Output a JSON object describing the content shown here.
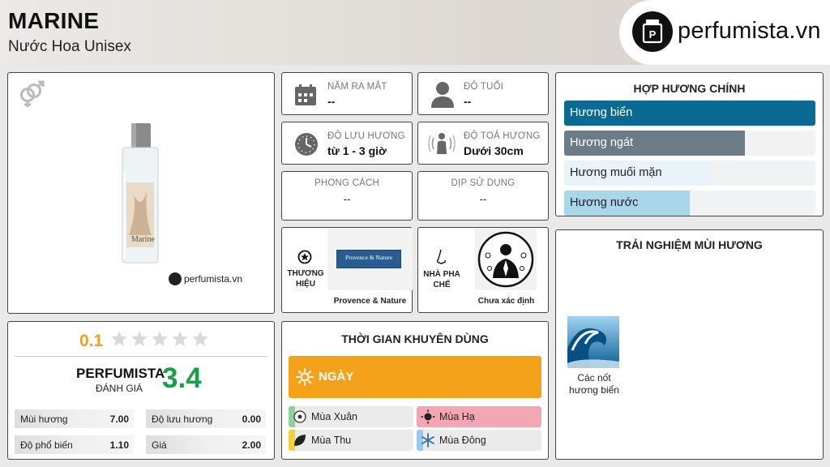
{
  "header": {
    "title": "MARINE",
    "subtitle": "Nước Hoa Unisex",
    "logo_text": "perfumista.vn"
  },
  "product": {
    "watermark": "perfumista.vn",
    "bottle_label": "Marine",
    "gender_icon": "unisex-gender-icon"
  },
  "info": {
    "release_label": "NĂM RA MẮT",
    "release_value": "--",
    "age_label": "ĐỘ TUỔI",
    "age_value": "--",
    "longevity_label": "ĐỘ LƯU HƯƠNG",
    "longevity_value": "từ 1 - 3 giờ",
    "sillage_label": "ĐỘ TOẢ HƯƠNG",
    "sillage_value": "Dưới 30cm",
    "style_label": "PHONG CÁCH",
    "style_value": "--",
    "occasion_label": "DỊP SỬ DỤNG",
    "occasion_value": "--"
  },
  "brand": {
    "label": "THƯƠNG HIỆU",
    "logo_text": "Provence & Nature",
    "name": "Provence & Nature"
  },
  "perfumer": {
    "label": "NHÀ PHA CHẾ",
    "name": "Chưa xác định"
  },
  "accords": {
    "title": "HỢP HƯƠNG CHÍNH",
    "items": [
      {
        "label": "Hương biển",
        "pct": 100,
        "color": "#0a6a93",
        "text_color": "#ffffff"
      },
      {
        "label": "Hương ngát",
        "pct": 72,
        "color": "#6b7b87",
        "text_color": "#ffffff"
      },
      {
        "label": "Hương muối mặn",
        "pct": 58,
        "color": "#e9f3fa",
        "text_color": "#222222"
      },
      {
        "label": "Hương nước",
        "pct": 50,
        "color": "#a9d6e8",
        "text_color": "#222222"
      }
    ]
  },
  "rating": {
    "user_score": "0.1",
    "stars": 0.1,
    "brand_label": "PERFUMISTA",
    "review_label": "ĐÁNH GIÁ",
    "score": "3.4",
    "rows": [
      {
        "label": "Mùi hương",
        "value": "7.00"
      },
      {
        "label": "Độ lưu hương",
        "value": "0.00"
      },
      {
        "label": "Độ phổ biến",
        "value": "1.10"
      },
      {
        "label": "Giá",
        "value": "2.00"
      }
    ]
  },
  "usage": {
    "title": "THỜI GIAN KHUYÊN DÙNG",
    "day_label": "NGÀY",
    "seasons": [
      {
        "label": "Mùa Xuân",
        "color": "#8fd19e",
        "active": false
      },
      {
        "label": "Mùa Hạ",
        "color": "#f3a6b3",
        "active": true
      },
      {
        "label": "Mùa Thu",
        "color": "#f2d23a",
        "active": false
      },
      {
        "label": "Mùa Đông",
        "color": "#9ec9ee",
        "active": false
      }
    ]
  },
  "experience": {
    "title": "TRẢI NGHIỆM MÙI HƯƠNG",
    "note_label": "Các nốt hương biển"
  }
}
